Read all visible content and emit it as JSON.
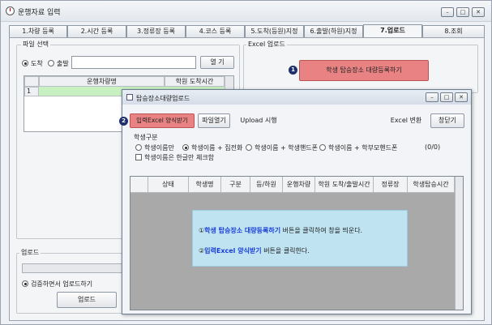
{
  "window": {
    "title": "운행자료 입력",
    "minimize": "–",
    "maximize": "□",
    "close": "✕"
  },
  "tabs": [
    {
      "label": "1.차량 등록"
    },
    {
      "label": "2.시간 등록"
    },
    {
      "label": "3.정류장 등록"
    },
    {
      "label": "4.코스 등록"
    },
    {
      "label": "5.도착(등원)지정"
    },
    {
      "label": "6.출발(하원)지정"
    },
    {
      "label": "7.업로드"
    },
    {
      "label": "8.조회"
    }
  ],
  "file_select": {
    "label": "파일 선택",
    "radio_arrive": "도착",
    "radio_depart": "출발",
    "path_value": "",
    "open_button": "열 기",
    "col_vehicle": "운행차량명",
    "col_time": "학원 도착시간",
    "row_number": "1"
  },
  "excel_upload": {
    "label": "Excel 업로드",
    "marker": "1",
    "button": "학생 탑승장소 대량등록하기"
  },
  "upload": {
    "label": "업로드",
    "checkbox_label": "검증하면서 업로드하기",
    "button": "업로드"
  },
  "dialog": {
    "title": "탑승장소대량업로드",
    "marker": "2",
    "btn_form": "입력Excel 양식받기",
    "btn_open": "파일열기",
    "btn_upload": "Upload 시행",
    "btn_convert": "Excel 변환",
    "btn_close": "창닫기",
    "student_type_label": "학생구분",
    "options": [
      "학생이름만",
      "학생이름 + 집전화",
      "학생이름 + 학생핸드폰",
      "학생이름 + 학부모핸드폰"
    ],
    "count": "(0/0)",
    "check_hangul": "학생이름은 한글만 체크함",
    "columns": [
      "상태",
      "학생명",
      "구분",
      "등/하원",
      "운행차량",
      "학원 도착/출발시간",
      "정류장",
      "학생탑승시간",
      "탑"
    ]
  },
  "note": {
    "line1_num": "①",
    "line1_bold": "학생 탑승장소 대량등록하기",
    "line1_rest": " 버튼을 클릭하여  창을 띄운다.",
    "line2_num": "②",
    "line2_bold": "입력Excel 양식받기",
    "line2_rest": " 버튼을 클릭한다."
  },
  "colors": {
    "accent_red": "#e98383",
    "marker": "#1f2f6b",
    "note_bg": "#bfe3f0",
    "highlight_text": "#1a3fd8"
  }
}
